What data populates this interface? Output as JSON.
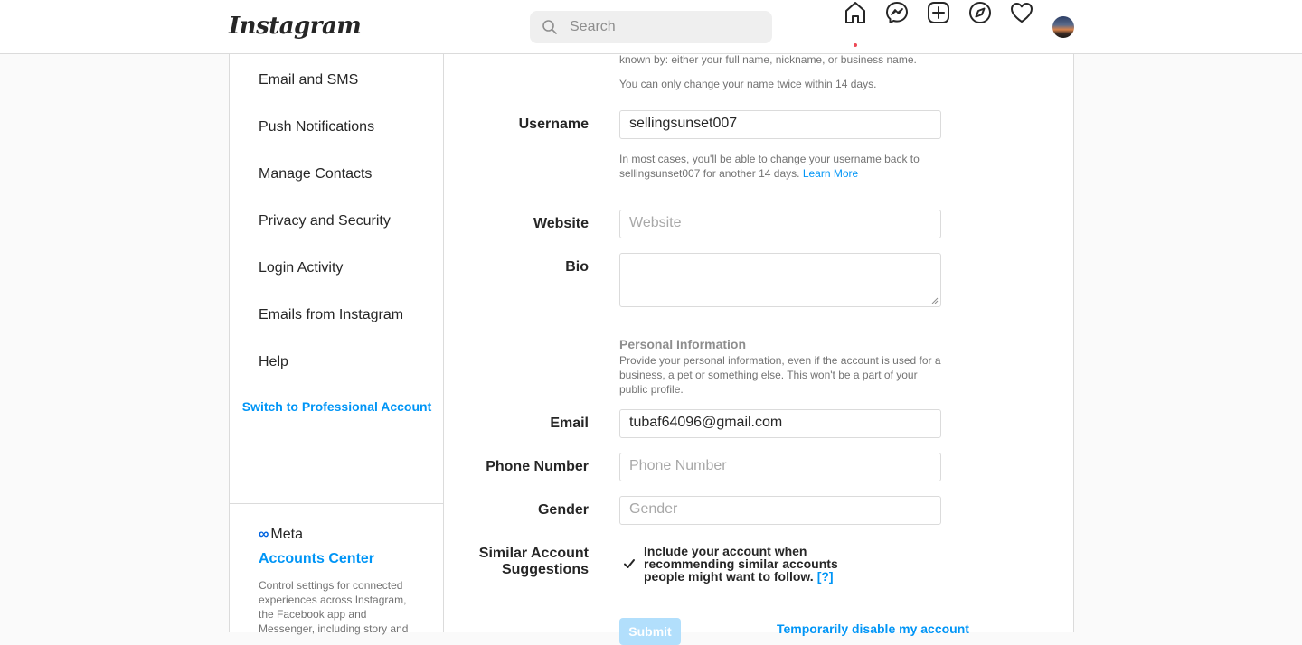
{
  "topbar": {
    "logo": "Instagram",
    "search_placeholder": "Search"
  },
  "sidebar": {
    "items": [
      {
        "label": "Email and SMS"
      },
      {
        "label": "Push Notifications"
      },
      {
        "label": "Manage Contacts"
      },
      {
        "label": "Privacy and Security"
      },
      {
        "label": "Login Activity"
      },
      {
        "label": "Emails from Instagram"
      },
      {
        "label": "Help"
      }
    ],
    "switch_professional": "Switch to Professional Account",
    "meta_logo": "Meta",
    "accounts_center": "Accounts Center",
    "accounts_center_desc": "Control settings for connected experiences across Instagram, the Facebook app and Messenger, including story and"
  },
  "form": {
    "name_hint_1": "known by: either your full name, nickname, or business name.",
    "name_hint_2": "You can only change your name twice within 14 days.",
    "username": {
      "label": "Username",
      "value": "sellingsunset007"
    },
    "username_hint": "In most cases, you'll be able to change your username back to sellingsunset007 for another 14 days.",
    "learn_more": "Learn More",
    "website": {
      "label": "Website",
      "placeholder": "Website"
    },
    "bio": {
      "label": "Bio",
      "value": ""
    },
    "personal_info_title": "Personal Information",
    "personal_info_desc": "Provide your personal information, even if the account is used for a business, a pet or something else. This won't be a part of your public profile.",
    "email": {
      "label": "Email",
      "value": "tubaf64096@gmail.com"
    },
    "phone": {
      "label": "Phone Number",
      "placeholder": "Phone Number"
    },
    "gender": {
      "label": "Gender",
      "placeholder": "Gender"
    },
    "similar": {
      "label_line1": "Similar Account",
      "label_line2": "Suggestions",
      "checked": true,
      "text": "Include your account when recommending similar accounts people might want to follow.",
      "help": "[?]"
    },
    "submit": "Submit",
    "disable_account": "Temporarily disable my account"
  },
  "colors": {
    "accent": "#0095f6",
    "border": "#dbdbdb",
    "muted": "#737373",
    "notification_dot": "#ed4956"
  }
}
